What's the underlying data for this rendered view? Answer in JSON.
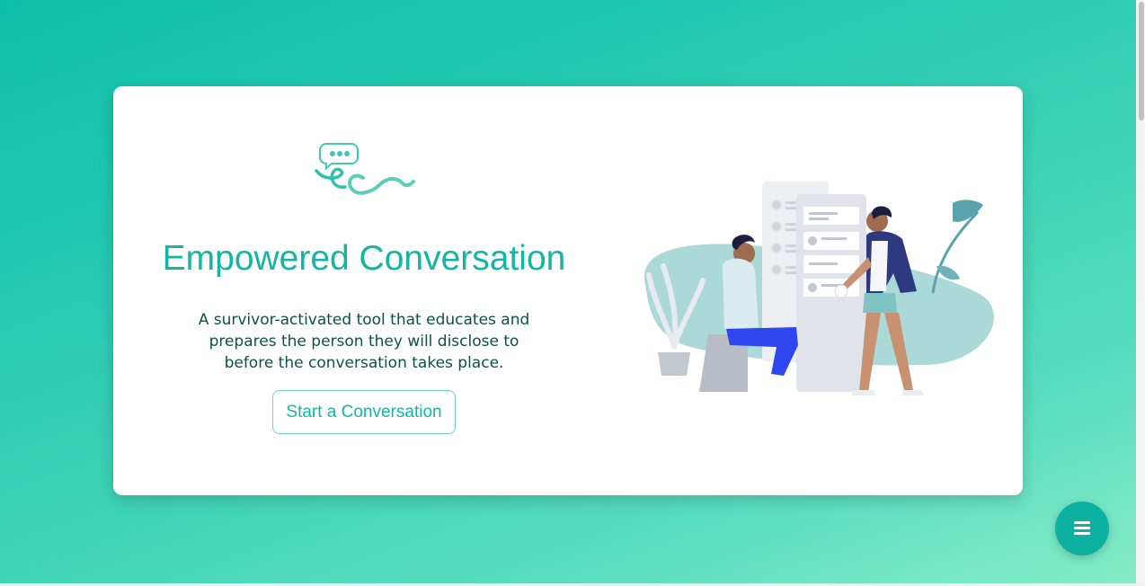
{
  "hero": {
    "title": "Empowered Conversation",
    "description": "A survivor-activated tool that educates and prepares the person they will disclose to before the conversation takes place.",
    "cta_label": "Start a Conversation"
  },
  "icons": {
    "logo": "empowered-conversation-logo",
    "illustration": "two-people-conversation-illustration",
    "menu": "hamburger-menu-icon"
  },
  "colors": {
    "brand_teal": "#13b5a3",
    "background_gradient_start": "#0cbfaa",
    "background_gradient_end": "#86ecc6",
    "text_dark": "#0e4f4a"
  }
}
